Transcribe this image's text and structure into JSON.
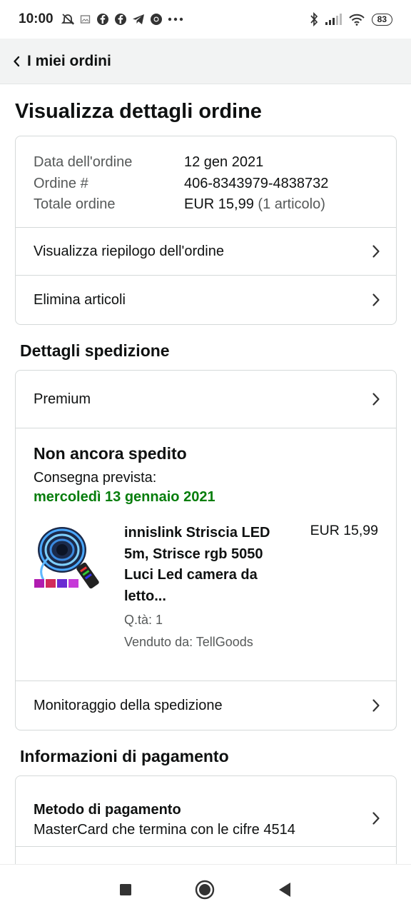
{
  "status_bar": {
    "time": "10:00",
    "icons_left": [
      "do-not-disturb-icon",
      "image-icon",
      "facebook-icon",
      "facebook-icon",
      "telegram-icon",
      "chrome-icon",
      "more-icon"
    ],
    "icons_right": [
      "bluetooth-icon",
      "signal-icon",
      "wifi-icon"
    ],
    "battery": "83"
  },
  "header": {
    "back_label": "I miei ordini"
  },
  "page": {
    "title": "Visualizza dettagli ordine"
  },
  "order_summary": {
    "rows": [
      {
        "label": "Data dell'ordine",
        "value": "12 gen 2021"
      },
      {
        "label": "Ordine #",
        "value": "406-8343979-4838732"
      },
      {
        "label": "Totale ordine",
        "value": "EUR 15,99",
        "extra": "(1 articolo)"
      }
    ],
    "links": [
      "Visualizza riepilogo dell'ordine",
      "Elimina articoli"
    ]
  },
  "shipping": {
    "section_title": "Dettagli spedizione",
    "method": "Premium",
    "status": "Non ancora spedito",
    "delivery_label": "Consegna prevista:",
    "delivery_date": "mercoledì 13 gennaio 2021",
    "item": {
      "title_lines": [
        "innislink Striscia LED",
        "5m, Strisce rgb 5050",
        "Luci Led camera da",
        "letto..."
      ],
      "qty": "Q.tà: 1",
      "seller": "Venduto da: TellGoods",
      "price": "EUR 15,99"
    },
    "tracking_link": "Monitoraggio della spedizione"
  },
  "payment": {
    "section_title": "Informazioni di pagamento",
    "method_title": "Metodo di pagamento",
    "method_desc": "MasterCard che termina con le cifre 4514"
  },
  "colors": {
    "green": "#067d0c",
    "header_bg": "#f2f3f3",
    "border": "#d5d9d9"
  }
}
